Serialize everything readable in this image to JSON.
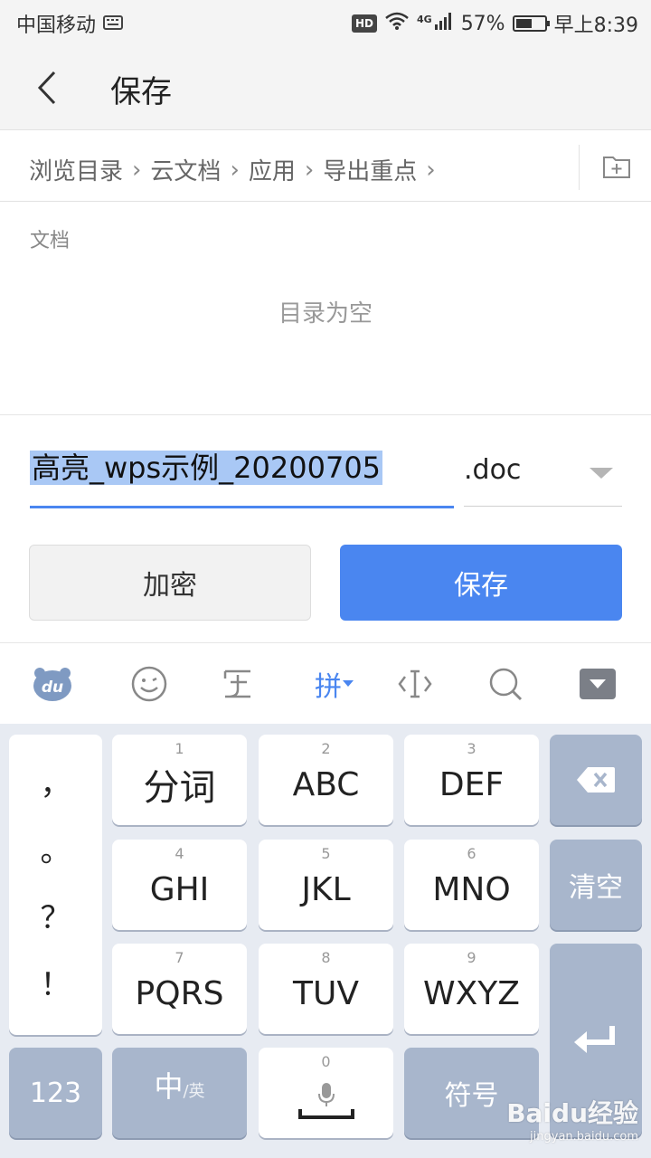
{
  "status_bar": {
    "carrier": "中国移动",
    "network": "4G",
    "hd_badge": "HD",
    "battery": "57%",
    "battery_level": 0.57,
    "time": "早上8:39"
  },
  "header": {
    "title": "保存"
  },
  "breadcrumb": {
    "items": [
      "浏览目录",
      "云文档",
      "应用",
      "导出重点"
    ],
    "separator": "›"
  },
  "file_list": {
    "section_label": "文档",
    "empty_text": "目录为空"
  },
  "save_form": {
    "filename": "高亮_wps示例_20200705",
    "extension": ".doc",
    "encrypt_label": "加密",
    "save_label": "保存"
  },
  "keyboard_toolbar": {
    "mode_label": "拼",
    "icons": [
      "du-logo-icon",
      "emoji-icon",
      "handwrite-icon",
      "cursor-icon",
      "search-icon",
      "collapse-keyboard-icon"
    ]
  },
  "keyboard": {
    "punctuation": [
      "，",
      "。",
      "？",
      "！"
    ],
    "keys": [
      {
        "num": "1",
        "label": "分词"
      },
      {
        "num": "2",
        "label": "ABC"
      },
      {
        "num": "3",
        "label": "DEF"
      },
      {
        "num": "4",
        "label": "GHI"
      },
      {
        "num": "5",
        "label": "JKL"
      },
      {
        "num": "6",
        "label": "MNO"
      },
      {
        "num": "7",
        "label": "PQRS"
      },
      {
        "num": "8",
        "label": "TUV"
      },
      {
        "num": "9",
        "label": "WXYZ"
      }
    ],
    "clear_label": "清空",
    "numeric_label": "123",
    "lang_main": "中",
    "lang_sub": "/英",
    "space_num": "0",
    "symbols_label": "符号"
  },
  "watermark": {
    "main": "Baidu经验",
    "sub": "jingyan.baidu.com"
  },
  "colors": {
    "accent": "#4a86f0",
    "selection": "#a9c8f5",
    "key_dark": "#a8b6cc",
    "keyboard_bg": "#e7ebf2"
  }
}
